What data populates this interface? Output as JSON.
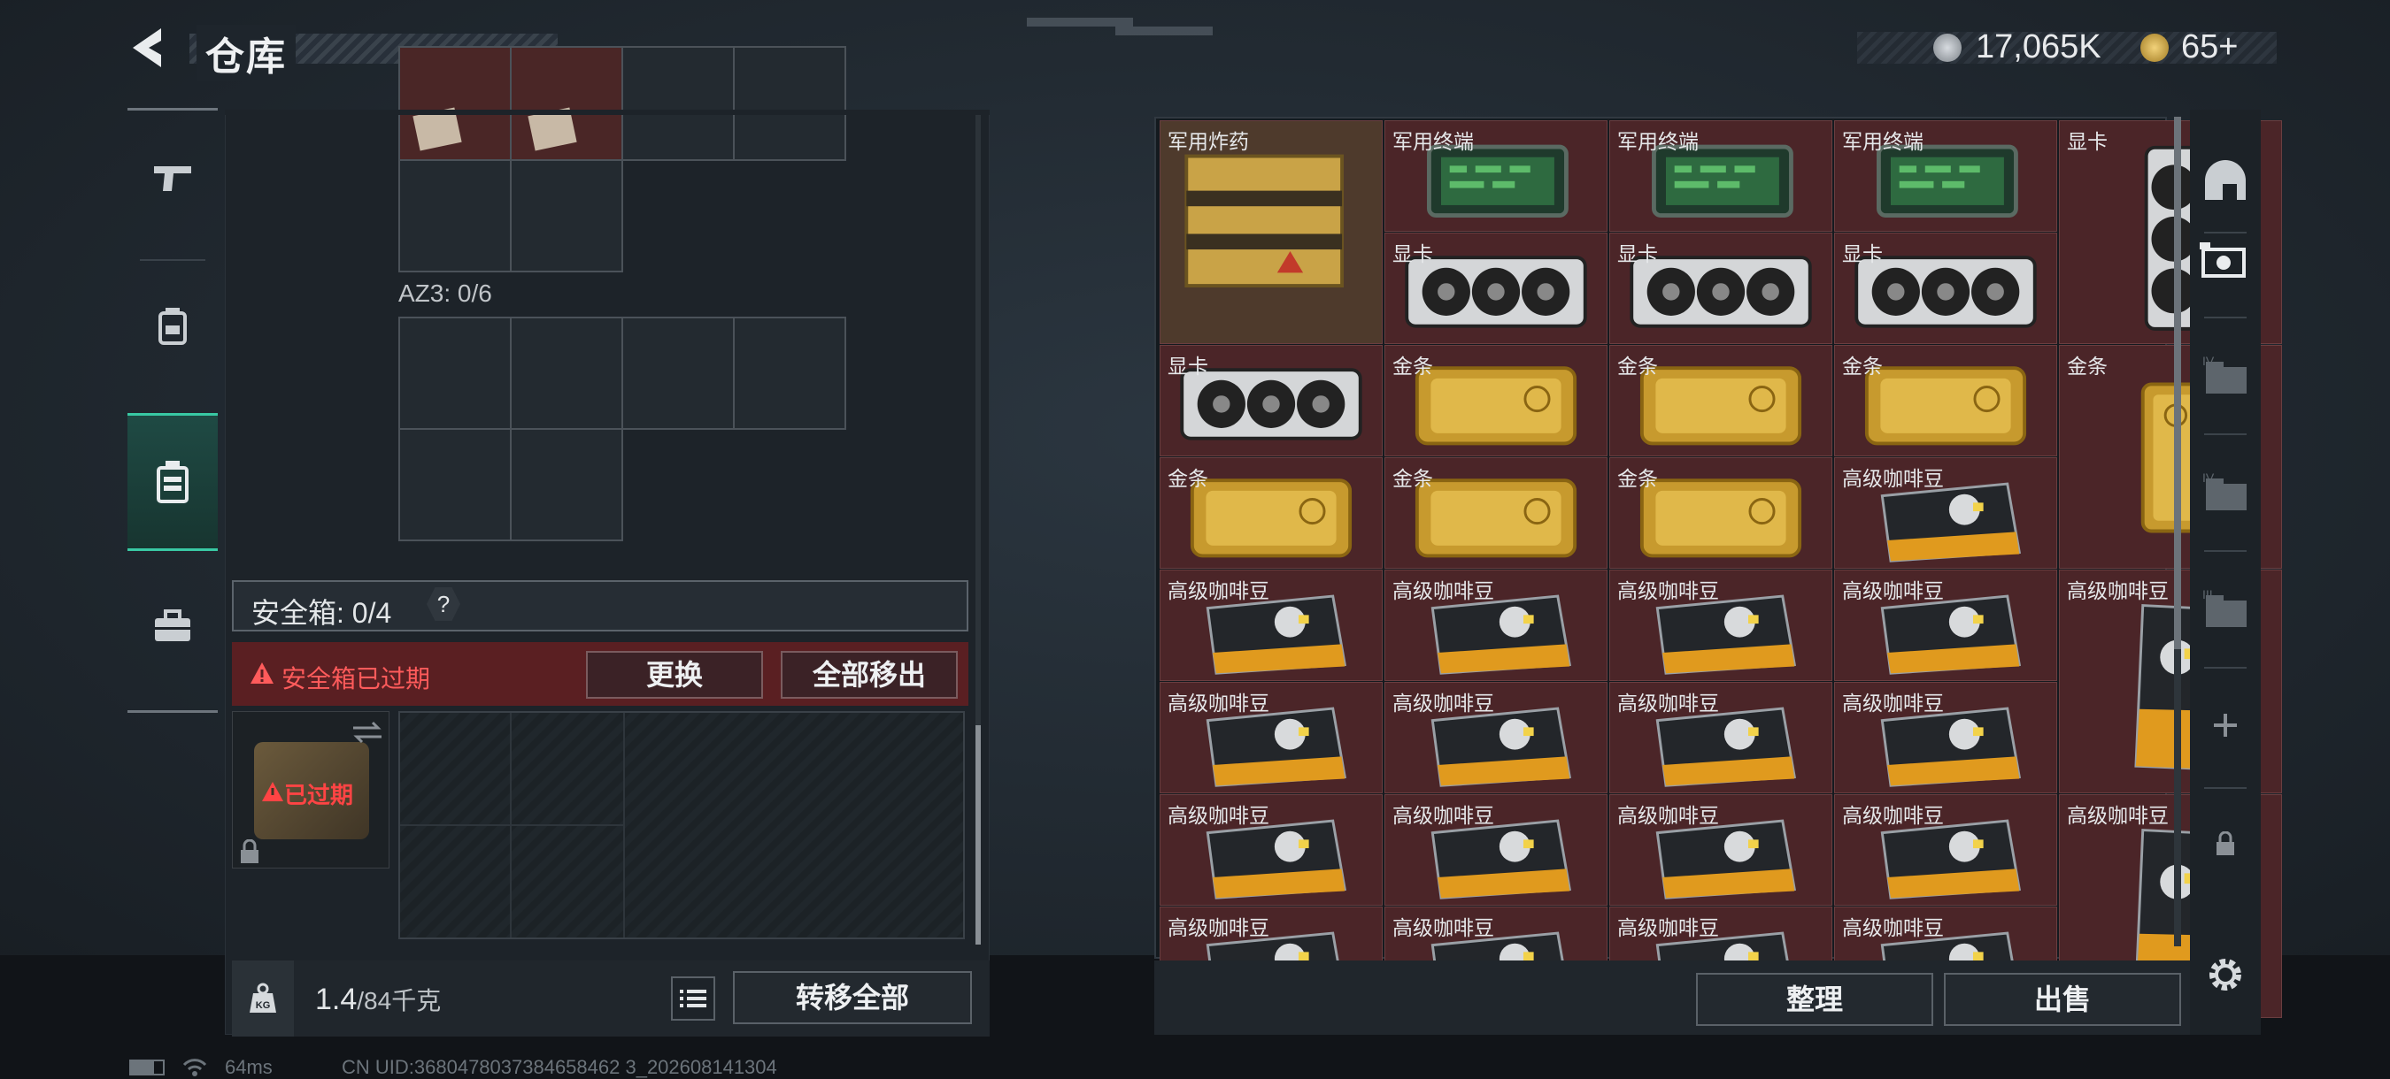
{
  "header": {
    "title": "仓库",
    "currency_primary": "17,065K",
    "currency_secondary": "65+"
  },
  "left_nav": [
    {
      "name": "weapon",
      "icon": "pistol-icon",
      "active": false
    },
    {
      "name": "armor",
      "icon": "backpack-icon",
      "active": false
    },
    {
      "name": "container",
      "icon": "container-icon",
      "active": true
    },
    {
      "name": "case",
      "icon": "briefcase-icon",
      "active": false
    }
  ],
  "container_panel": {
    "az3_label": "AZ3: 0/6",
    "safe_box_label": "安全箱: 0/4",
    "help_label": "?",
    "alert_text": "安全箱已过期",
    "replace_button": "更换",
    "move_all_out_button": "全部移出",
    "expired_tag": "已过期",
    "weight_current": "1.4",
    "weight_capacity": "/84千克",
    "transfer_all_button": "转移全部"
  },
  "storage": {
    "items": [
      {
        "label": "军用炸药",
        "kind": "explosive-box"
      },
      {
        "label": "军用终端",
        "kind": "terminal"
      },
      {
        "label": "军用终端",
        "kind": "terminal"
      },
      {
        "label": "军用终端",
        "kind": "terminal"
      },
      {
        "label": "显卡",
        "kind": "gpu-vertical"
      },
      {
        "label": "显卡",
        "kind": "gpu"
      },
      {
        "label": "显卡",
        "kind": "gpu"
      },
      {
        "label": "显卡",
        "kind": "gpu"
      },
      {
        "label": "显卡",
        "kind": "gpu"
      },
      {
        "label": "金条",
        "kind": "gold-bar"
      },
      {
        "label": "金条",
        "kind": "gold-bar"
      },
      {
        "label": "金条",
        "kind": "gold-bar"
      },
      {
        "label": "金条",
        "kind": "gold-bar-vertical"
      },
      {
        "label": "金条",
        "kind": "gold-bar"
      },
      {
        "label": "金条",
        "kind": "gold-bar"
      },
      {
        "label": "金条",
        "kind": "gold-bar"
      },
      {
        "label": "高级咖啡豆",
        "kind": "coffee"
      },
      {
        "label": "高级咖啡豆",
        "kind": "coffee"
      },
      {
        "label": "高级咖啡豆",
        "kind": "coffee"
      },
      {
        "label": "高级咖啡豆",
        "kind": "coffee"
      },
      {
        "label": "高级咖啡豆",
        "kind": "coffee"
      },
      {
        "label": "高级咖啡豆",
        "kind": "coffee-vertical"
      },
      {
        "label": "高级咖啡豆",
        "kind": "coffee"
      },
      {
        "label": "高级咖啡豆",
        "kind": "coffee"
      },
      {
        "label": "高级咖啡豆",
        "kind": "coffee"
      },
      {
        "label": "高级咖啡豆",
        "kind": "coffee"
      },
      {
        "label": "高级咖啡豆",
        "kind": "coffee"
      },
      {
        "label": "高级咖啡豆",
        "kind": "coffee"
      },
      {
        "label": "高级咖啡豆",
        "kind": "coffee"
      },
      {
        "label": "高级咖啡豆",
        "kind": "coffee"
      },
      {
        "label": "高级咖啡豆",
        "kind": "coffee-vertical"
      },
      {
        "label": "高级咖啡豆",
        "kind": "coffee"
      },
      {
        "label": "高级咖啡豆",
        "kind": "coffee"
      },
      {
        "label": "高级咖啡豆",
        "kind": "coffee"
      },
      {
        "label": "高级咖啡豆",
        "kind": "coffee"
      }
    ],
    "sort_button": "整理",
    "sell_button": "出售"
  },
  "right_tabs": [
    {
      "icon": "helmet-icon"
    },
    {
      "icon": "vehicle-icon"
    },
    {
      "icon": "folder-iv-icon"
    },
    {
      "icon": "folder-iv-icon"
    },
    {
      "icon": "folder-iii-icon"
    },
    {
      "icon": "plus-icon"
    },
    {
      "icon": "lock-icon"
    },
    {
      "icon": "gear-icon"
    }
  ],
  "status_bar": {
    "ping": "64ms",
    "uid": "CN UID:3680478037384658462 3_202608141304"
  },
  "colors": {
    "accent_teal": "#39c9a4",
    "alert_red": "#ff5b5b",
    "storage_cell": "#4b2528"
  }
}
